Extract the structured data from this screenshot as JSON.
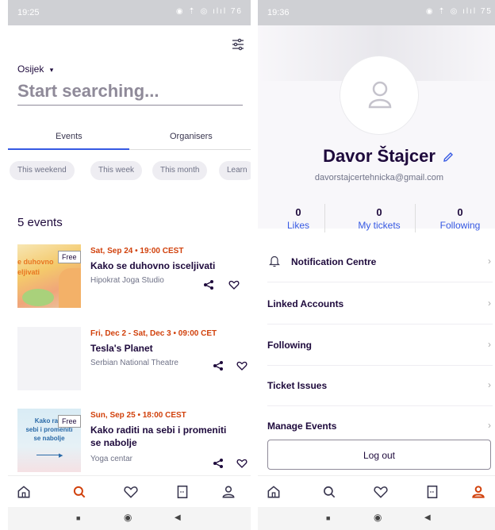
{
  "left": {
    "status_time": "19:25",
    "status_icons": "◉ ⇡  ◎ ılıl 76",
    "location": "Osijek",
    "search_placeholder": "Start searching...",
    "tabs": [
      "Events",
      "Organisers"
    ],
    "chips": [
      "This weekend",
      "This week",
      "This month",
      "Learn"
    ],
    "events_count": "5 events",
    "events": [
      {
        "date": "Sat, Sep 24 • 19:00 CEST",
        "title": "Kako se duhovno isceljivati",
        "organizer": "Hipokrat Joga Studio",
        "badge": "Free",
        "thumb_text": "e duhovno\neljivati"
      },
      {
        "date": "Fri, Dec 2 - Sat, Dec 3 • 09:00 CET",
        "title": "Tesla's Planet",
        "organizer": "Serbian National Theatre"
      },
      {
        "date": "Sun, Sep 25 • 18:00 CEST",
        "title": "Kako raditi na sebi i promeniti se nabolje",
        "organizer": "Yoga centar",
        "badge": "Free",
        "thumb_text": "Kako radi\nsebi i promeniti\nse nabolje"
      }
    ]
  },
  "right": {
    "status_time": "19:36",
    "status_icons": "◉ ⇡  ◎ ılıl 75",
    "name": "Davor Štajcer",
    "email": "davorstajcertehnicka@gmail.com",
    "stats": [
      {
        "num": "0",
        "label": "Likes"
      },
      {
        "num": "0",
        "label": "My tickets"
      },
      {
        "num": "0",
        "label": "Following"
      }
    ],
    "menu": [
      "Notification Centre",
      "Linked Accounts",
      "Following",
      "Ticket Issues",
      "Manage Events"
    ],
    "logout": "Log out"
  },
  "colors": {
    "accent_orange": "#d1410c",
    "accent_blue": "#3659e3",
    "text_dark": "#1e0a3c",
    "text_muted": "#6f7287"
  }
}
